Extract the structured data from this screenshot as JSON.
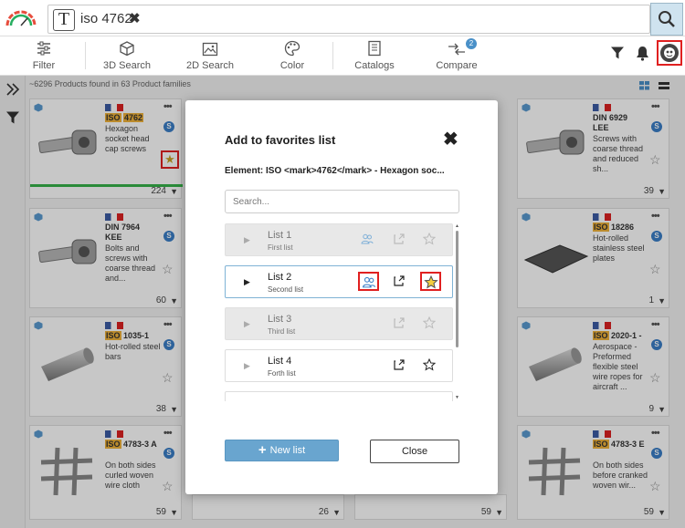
{
  "search": {
    "query": "iso 4762",
    "clear_symbol": "✖"
  },
  "toolbar": {
    "filter": "Filter",
    "search3d": "3D Search",
    "search2d": "2D Search",
    "color": "Color",
    "catalogs": "Catalogs",
    "compare": "Compare",
    "compare_badge": "2"
  },
  "results": {
    "summary": "~6296 Products found in 63 Product families"
  },
  "cards": [
    {
      "code": "ISO",
      "num": "4762",
      "desc": "Hexagon socket head cap screws",
      "count": "224"
    },
    {
      "code": "DIN 6929 LEE",
      "desc": "Screws with coarse thread and reduced sh...",
      "count": "39"
    },
    {
      "code": "DIN 7964 KEE",
      "desc": "Bolts and screws with coarse thread and...",
      "count": "60"
    },
    {
      "code": "ISO",
      "num": "18286",
      "desc": "Hot-rolled stainless steel plates",
      "count": "1"
    },
    {
      "code": "ISO",
      "num": "1035-1",
      "desc": "Hot-rolled steel bars",
      "count": "38"
    },
    {
      "code": "ISO",
      "num": "2020-1 -",
      "desc": "Aerospace - Preformed flexible steel wire ropes for aircraft ...",
      "count": "9"
    },
    {
      "code": "ISO",
      "num": "4783-3 A",
      "desc": "On both sides curled woven wire cloth",
      "count": "59"
    },
    {
      "code": "ISO",
      "num": "4783-3 E",
      "desc": "On both sides before cranked woven wir...",
      "count": "59"
    },
    {
      "count": "26"
    },
    {
      "count": "59"
    }
  ],
  "modal": {
    "title": "Add to favorites list",
    "element": "Element: ISO <mark>4762</mark> - Hexagon soc...",
    "search_placeholder": "Search...",
    "lists": [
      {
        "name": "List 1",
        "sub": "First list"
      },
      {
        "name": "List 2",
        "sub": "Second list"
      },
      {
        "name": "List 3",
        "sub": "Third list"
      },
      {
        "name": "List 4",
        "sub": "Forth list"
      }
    ],
    "new_list": "New list",
    "close": "Close"
  }
}
